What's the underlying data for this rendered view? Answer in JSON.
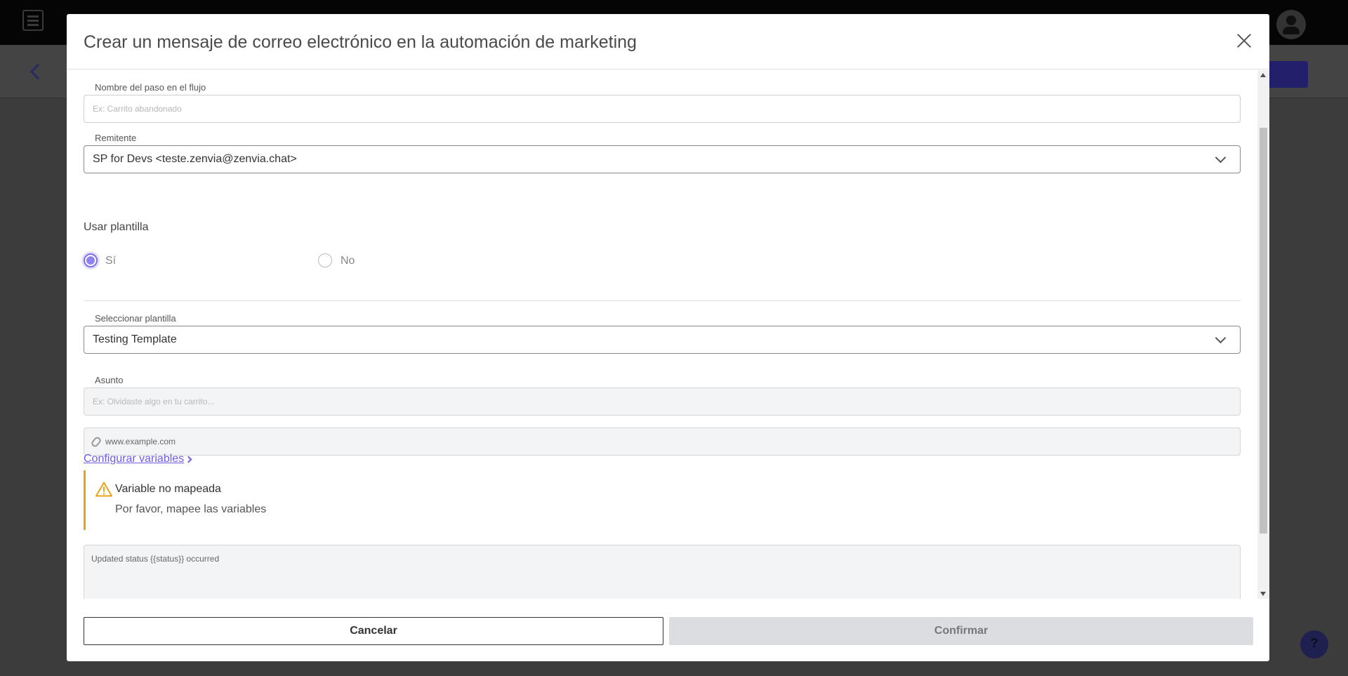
{
  "modal": {
    "title": "Crear un mensaje de correo electrónico en la automación de marketing"
  },
  "form": {
    "step_name": {
      "label": "Nombre del paso en el flujo",
      "placeholder": "Ex: Carrito abandonado"
    },
    "sender": {
      "label": "Remitente",
      "value": "SP for Devs <teste.zenvia@zenvia.chat>"
    },
    "use_template": {
      "label": "Usar plantilla",
      "options": [
        {
          "label": "Sí",
          "selected": true
        },
        {
          "label": "No",
          "selected": false
        }
      ]
    },
    "template": {
      "label": "Seleccionar plantilla",
      "value": "Testing Template"
    },
    "subject": {
      "label": "Asunto",
      "placeholder": "Ex: Olvidaste algo en tu carrito..."
    },
    "attachment": {
      "value": "www.example.com"
    },
    "configure_variables_link": "Configurar variables",
    "alert": {
      "title": "Variable no mapeada",
      "text": "Por favor, mapee las variables"
    },
    "body_text": "Updated status {{status}} occurred"
  },
  "footer": {
    "cancel_label": "Cancelar",
    "confirm_label": "Confirmar"
  },
  "colors": {
    "accent": "#6d5ce8",
    "warning": "#e8a317",
    "disabled_button": "#dcdde1"
  }
}
